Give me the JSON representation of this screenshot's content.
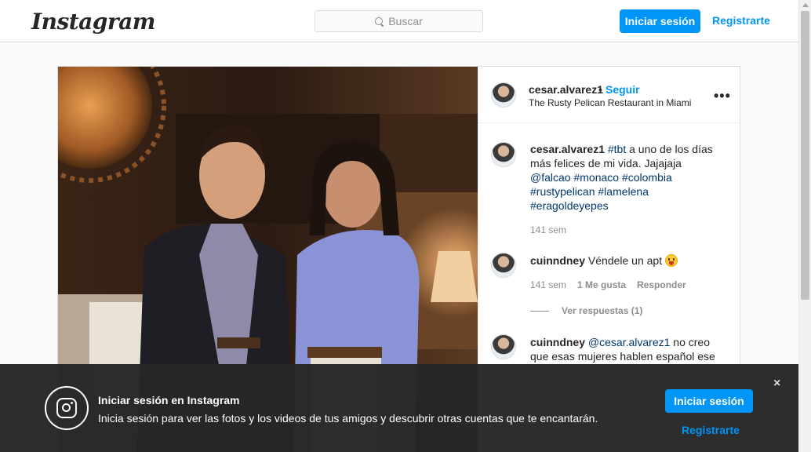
{
  "header": {
    "logo": "Instagram",
    "search_placeholder": "Buscar",
    "login_label": "Iniciar sesión",
    "register_label": "Registrarte"
  },
  "post": {
    "owner": "cesar.alvarez1",
    "separator": "•",
    "follow_label": "Seguir",
    "location": "The Rusty Pelican Restaurant in Miami",
    "more_label": "•••",
    "caption": {
      "user": "cesar.alvarez1",
      "text_before": " ",
      "tbt": "#tbt",
      "text": " a uno de los días más felices de mi vida. Jajajaja ",
      "tags": [
        "@falcao",
        "#monaco",
        "#colombia",
        "#rustypelican",
        "#lamelena",
        "#eragoldeyepes"
      ],
      "time": "141 sem"
    },
    "comments": [
      {
        "user": "cuinndney",
        "text": "Véndele un apt",
        "emoji": "face-with-tongue",
        "time": "141 sem",
        "likes": "1 Me gusta",
        "reply_label": "Responder",
        "view_replies": "Ver respuestas (1)"
      },
      {
        "user": "cuinndney",
        "mention": "@cesar.alvarez1",
        "text": " no creo que esas mujeres hablen español ese"
      }
    ]
  },
  "banner": {
    "title": "Iniciar sesión en Instagram",
    "subtitle": "Inicia sesión para ver las fotos y los videos de tus amigos y descubrir otras cuentas que te encantarán.",
    "login_label": "Iniciar sesión",
    "register_label": "Registrarte",
    "close_label": "×"
  }
}
